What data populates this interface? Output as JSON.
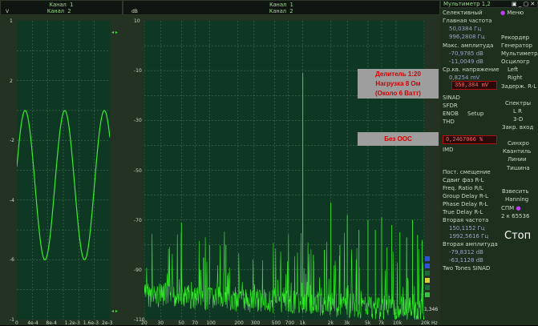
{
  "scope": {
    "channel1": "Канал 1",
    "channel2": "Канал 2",
    "v_label": "V",
    "y_ticks": [
      "1",
      "",
      "2",
      "",
      "-2",
      "",
      "-4",
      "",
      "-6",
      "",
      "-1"
    ],
    "x_ticks": [
      "0",
      "4e-4",
      "8e-4",
      "1.2e-3",
      "1.6e-3",
      "2e-3"
    ]
  },
  "spectrum": {
    "channel1": "Канал 1",
    "channel2": "Канал 2",
    "db_label": "dB",
    "y_ticks": [
      "10",
      "-10",
      "-30",
      "-50",
      "-70",
      "-90",
      "-110"
    ],
    "x_ticks": [
      "20",
      "30",
      "50",
      "70",
      "100",
      "200",
      "300",
      "500",
      "700",
      "1k",
      "2k",
      "3k",
      "5k",
      "7k",
      "10k",
      "20k Hz"
    ],
    "note1": [
      "Делитель 1:20",
      "Нагрузка 8 Ом",
      "(Около 6 Ватт)"
    ],
    "note2": "Без ООС",
    "bottom_value": "1,346"
  },
  "panel": {
    "title": "Мультиметр 1,2",
    "selective": "Селективный",
    "menu": "Меню",
    "freq_label": "Главная частота",
    "freq_l": "50,0384 Гц",
    "freq_r": "996,2808 Гц",
    "amp_label": "Макс. амплитуда",
    "amp_l": "-70,9785 dB",
    "amp_r": "-11,0049 dB",
    "voltage_label": "Ср.кв. напряжение",
    "voltage_l": "0,8254 mV",
    "voltage_r": "350,384 mV",
    "recorder": "Рекордер",
    "generator": "Генератор",
    "multimeter": "Мультиметр",
    "oscillograph": "Осцилогр",
    "left": "Left",
    "right": "Right",
    "delay": "Задерж. R-L",
    "sinad": "SINAD",
    "sfdr": "SFDR",
    "enob": "ENOB",
    "setup": "Setup",
    "thd": "THD",
    "thd_value": "0,2467066 %",
    "imd": "IMD",
    "spectra": "Спектры",
    "l_r": "L R",
    "three_d": "3-D",
    "close_input": "Закр. вход",
    "sync": "Синхро",
    "quantile": "Квантиль",
    "lines": "Линии",
    "noise": "Тишина",
    "weighting": "Взвесить",
    "hanning": "Hanning",
    "spm": "СПМ",
    "dc_offset": "Пост. смещение",
    "phase_shift": "Сдвиг фаз R-L",
    "freq_ratio": "Freq. Ratio R/L",
    "group_delay": "Group Delay R-L",
    "phase_delay": "Phase Delay R-L",
    "time_delay": "True Delay R-L",
    "second_freq": "Вторая частота",
    "second_freq_l": "150,1152 Гц",
    "second_freq_r": "1992,5616 Гц",
    "second_amp": "Вторая амплитуда",
    "second_amp_l": "-79,8312 dB",
    "second_amp_r": "-63,1128 dB",
    "two_tones": "Two Tones SINAD",
    "stop": "Стоп",
    "samples": "2 к 65536"
  },
  "colors": {
    "trace": "#36ef2c",
    "plot_bg": "#0f3824",
    "grid": "#4f7a62",
    "alert": "#ff2a2a"
  }
}
